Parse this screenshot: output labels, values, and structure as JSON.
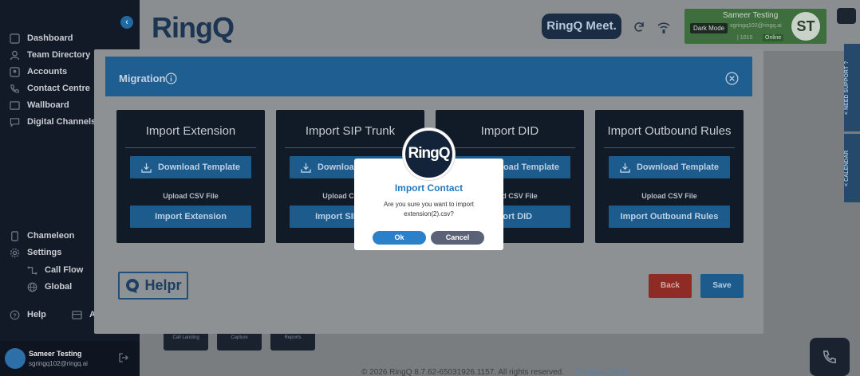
{
  "app": {
    "logo_text": "RingQ"
  },
  "sidebar": {
    "collapse_glyph": "‹",
    "items": [
      {
        "label": "Dashboard",
        "icon": "dashboard-icon"
      },
      {
        "label": "Team Directory",
        "icon": "team-icon"
      },
      {
        "label": "Accounts",
        "icon": "accounts-icon"
      },
      {
        "label": "Contact Centre",
        "icon": "phone-icon"
      },
      {
        "label": "Wallboard",
        "icon": "wallboard-icon"
      },
      {
        "label": "Digital Channels",
        "icon": "chat-icon"
      },
      {
        "label": "Chameleon",
        "icon": "chameleon-icon"
      },
      {
        "label": "Settings",
        "icon": "gear-icon"
      },
      {
        "label": "Call Flow",
        "icon": "call-flow-icon"
      },
      {
        "label": "Global",
        "icon": "globe-icon"
      },
      {
        "label": "Help",
        "icon": "help-icon"
      },
      {
        "label": "A",
        "icon": "apps-icon"
      }
    ],
    "user": {
      "name": "Sameer Testing",
      "email": "sgringq102@ringq.ai"
    }
  },
  "header": {
    "meet_label": "RingQ Meet.",
    "profile": {
      "name": "Sameer Testing",
      "dark_mode_label": "Dark Mode",
      "email": "sgringq102@ringq.ai",
      "ext": "| 1010",
      "status": "Online",
      "initials": "ST"
    },
    "side_tabs": {
      "support": "< NEED SUPPORT ?",
      "calendar": "< CALENDAR"
    }
  },
  "background": {
    "cards": [
      "Call Landing",
      "Capture",
      "Reports"
    ],
    "footer_text": "© 2026 RingQ 8.7.62-65031926.1157. All rights reserved.",
    "footer_link": "Previous Builds"
  },
  "migration": {
    "title": "Migration",
    "cards": [
      {
        "title": "Import Extension",
        "download_label": "Download Template",
        "upload_label": "Upload CSV File",
        "import_label": "Import Extension"
      },
      {
        "title": "Import SIP Trunk",
        "download_label": "Download Template",
        "upload_label": "Upload CSV File",
        "import_label": "Import SIP Trunk"
      },
      {
        "title": "Import DID",
        "download_label": "Download Template",
        "upload_label": "Upload CSV File",
        "import_label": "Import DID"
      },
      {
        "title": "Import Outbound Rules",
        "download_label": "Download Template",
        "upload_label": "Upload CSV File",
        "import_label": "Import Outbound Rules"
      }
    ],
    "helpr_label": "Helpr",
    "back_label": "Back",
    "save_label": "Save"
  },
  "confirm": {
    "logo_text": "RingQ",
    "title": "Import Contact",
    "message": "Are you sure you want to import extension(2).csv?",
    "ok_label": "Ok",
    "cancel_label": "Cancel"
  },
  "colors": {
    "sidebar_bg": "#111a26",
    "primary": "#2c7fc9",
    "modal_header": "#1f5e90",
    "card_bg": "#111a27",
    "danger": "#8f2b25",
    "online": "#3e6e3e"
  }
}
